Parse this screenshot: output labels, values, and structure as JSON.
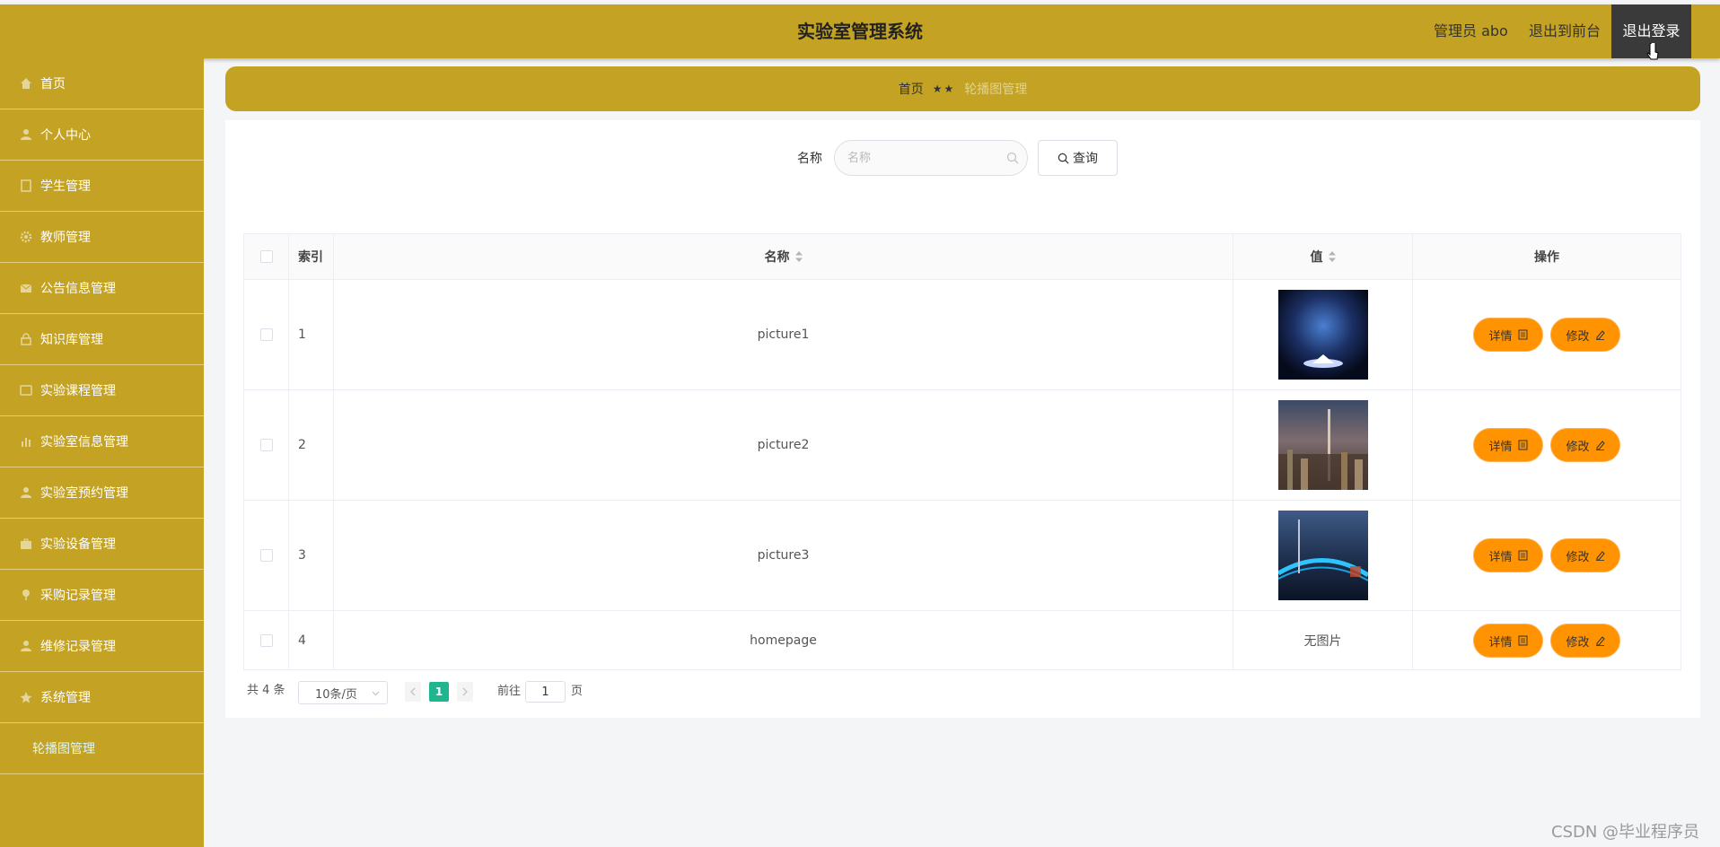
{
  "header": {
    "title": "实验室管理系统",
    "user_label": "管理员 abo",
    "front_link": "退出到前台",
    "logout_label": "退出登录"
  },
  "sidebar": {
    "items": [
      {
        "label": "首页",
        "icon": "home-icon"
      },
      {
        "label": "个人中心",
        "icon": "user-icon"
      },
      {
        "label": "学生管理",
        "icon": "document-icon"
      },
      {
        "label": "教师管理",
        "icon": "gear-icon"
      },
      {
        "label": "公告信息管理",
        "icon": "mail-icon"
      },
      {
        "label": "知识库管理",
        "icon": "lock-icon"
      },
      {
        "label": "实验课程管理",
        "icon": "tablet-icon"
      },
      {
        "label": "实验室信息管理",
        "icon": "chart-icon"
      },
      {
        "label": "实验室预约管理",
        "icon": "user-icon"
      },
      {
        "label": "实验设备管理",
        "icon": "briefcase-icon"
      },
      {
        "label": "采购记录管理",
        "icon": "pin-icon"
      },
      {
        "label": "维修记录管理",
        "icon": "user-icon"
      },
      {
        "label": "系统管理",
        "icon": "star-icon"
      }
    ],
    "submenu": [
      {
        "label": "轮播图管理"
      }
    ]
  },
  "breadcrumb": {
    "home": "首页",
    "separator": "★★",
    "current": "轮播图管理"
  },
  "search": {
    "label": "名称",
    "placeholder": "名称",
    "button_label": "查询"
  },
  "table": {
    "columns": {
      "index": "索引",
      "name": "名称",
      "value": "值",
      "actions": "操作"
    },
    "rows": [
      {
        "index": "1",
        "name": "picture1",
        "value": "",
        "image": "night-sky-photo"
      },
      {
        "index": "2",
        "name": "picture2",
        "value": "",
        "image": "city-skyline-photo"
      },
      {
        "index": "3",
        "name": "picture3",
        "value": "",
        "image": "bridge-night-photo"
      },
      {
        "index": "4",
        "name": "homepage",
        "value": "无图片",
        "image": ""
      }
    ],
    "detail_label": "详情",
    "edit_label": "修改"
  },
  "pagination": {
    "total": "共 4 条",
    "page_size": "10条/页",
    "current_page": "1",
    "goto_prefix": "前往",
    "goto_value": "1",
    "goto_suffix": "页"
  },
  "watermark": "CSDN @毕业程序员",
  "colors": {
    "primary": "#c4a223",
    "action": "#ff9301",
    "active_page": "#1fb58f",
    "logout_bg": "#3a3a3a"
  }
}
